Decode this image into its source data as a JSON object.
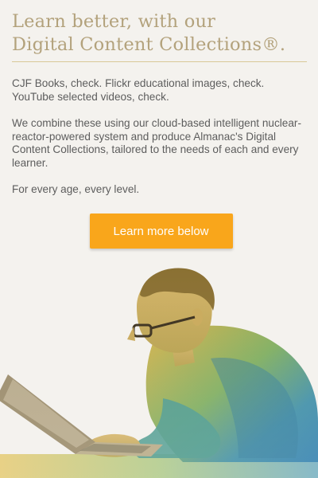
{
  "headline": {
    "line1": "Learn better, with our",
    "line2": "Digital Content Collections®."
  },
  "body": {
    "paragraph1": "CJF Books, check. Flickr educational images, check. YouTube selected videos, check.",
    "paragraph2": "We combine these using our cloud-based intelligent nuclear-reactor-powered system and produce Almanac's Digital Content Collections, tailored to the needs of each and every learner.",
    "paragraph3": "For every age, every level."
  },
  "cta": {
    "label": "Learn more below"
  },
  "colors": {
    "background": "#f4f2ee",
    "headline": "#b3a27c",
    "divider": "#d9c998",
    "button": "#f9a61b",
    "button_text": "#ffffff",
    "body_text": "#5d5d5d"
  },
  "hero": {
    "icon": "person-using-laptop-photo"
  }
}
